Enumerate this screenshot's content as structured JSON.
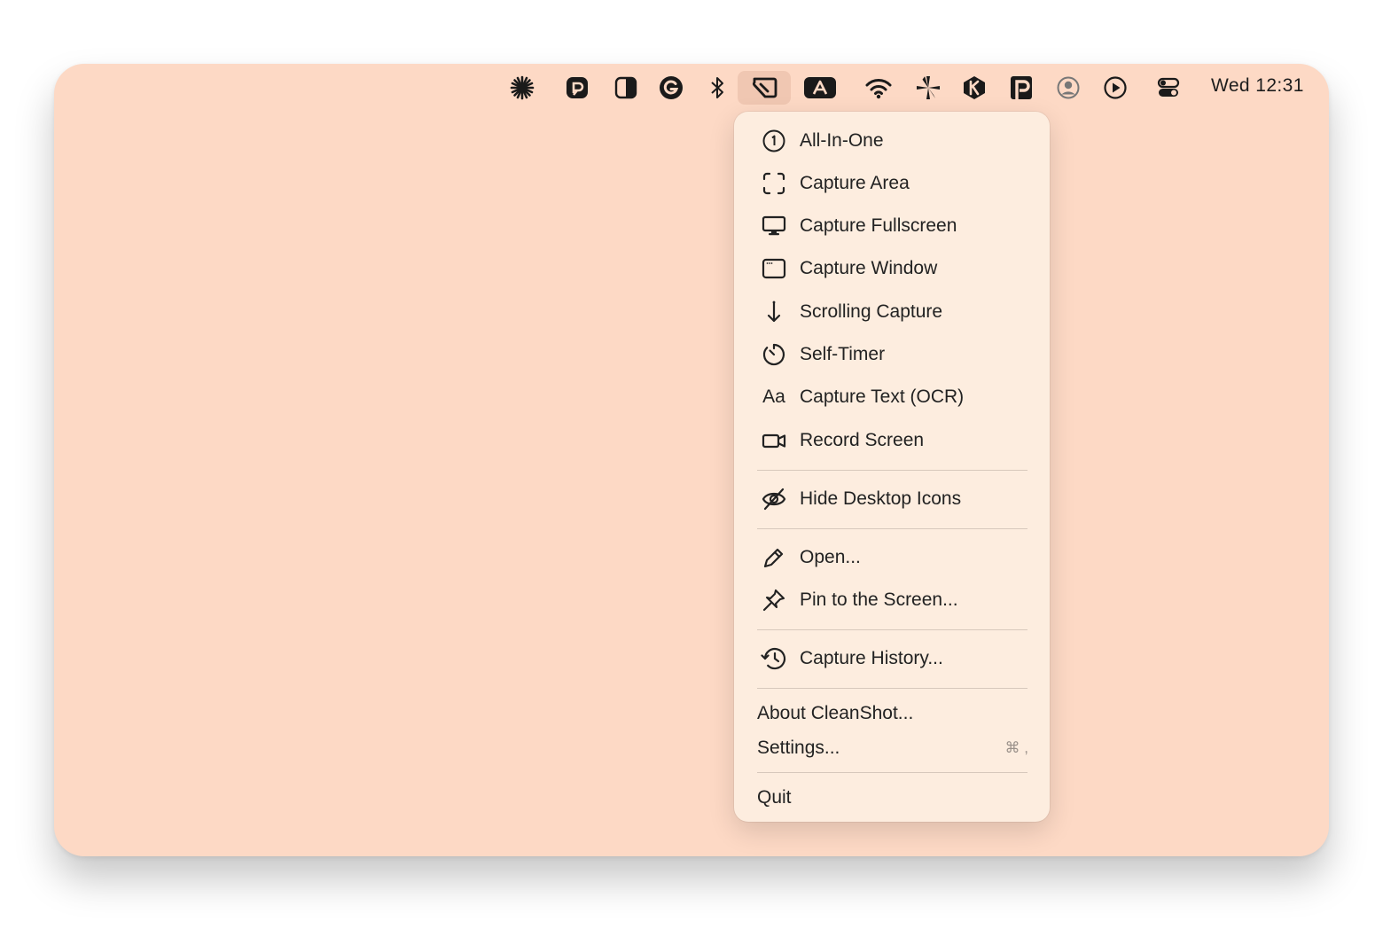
{
  "menubar": {
    "clock": "Wed 12:31",
    "icons": [
      "asterisk-icon",
      "p-circle-app-icon",
      "contrast-icon",
      "grammarly-icon",
      "bluetooth-icon",
      "cleanshot-icon",
      "a-text-icon",
      "wifi-icon",
      "pinwheel-icon",
      "k-app-icon",
      "p-square-app-icon",
      "user-account-icon",
      "play-circle-icon",
      "control-center-icon"
    ]
  },
  "menu": {
    "items": [
      {
        "label": "All-In-One",
        "icon": "circle-one-icon"
      },
      {
        "label": "Capture Area",
        "icon": "capture-area-icon"
      },
      {
        "label": "Capture Fullscreen",
        "icon": "monitor-icon"
      },
      {
        "label": "Capture Window",
        "icon": "window-icon"
      },
      {
        "label": "Scrolling Capture",
        "icon": "arrow-down-icon"
      },
      {
        "label": "Self-Timer",
        "icon": "timer-icon"
      },
      {
        "label": "Capture Text (OCR)",
        "icon": "text-aa-icon",
        "icon_text": "Aa"
      },
      {
        "label": "Record Screen",
        "icon": "video-camera-icon"
      },
      {
        "label": "Hide Desktop Icons",
        "icon": "eye-slash-icon"
      },
      {
        "label": "Open...",
        "icon": "pencil-icon"
      },
      {
        "label": "Pin to the Screen...",
        "icon": "pin-icon"
      },
      {
        "label": "Capture History...",
        "icon": "history-icon"
      },
      {
        "label": "About CleanShot..."
      },
      {
        "label": "Settings...",
        "shortcut": "⌘ ,"
      },
      {
        "label": "Quit"
      }
    ]
  },
  "colors": {
    "desktop": "#fdd9c5",
    "menu_bg": "#fdeddf",
    "text": "#222222"
  }
}
